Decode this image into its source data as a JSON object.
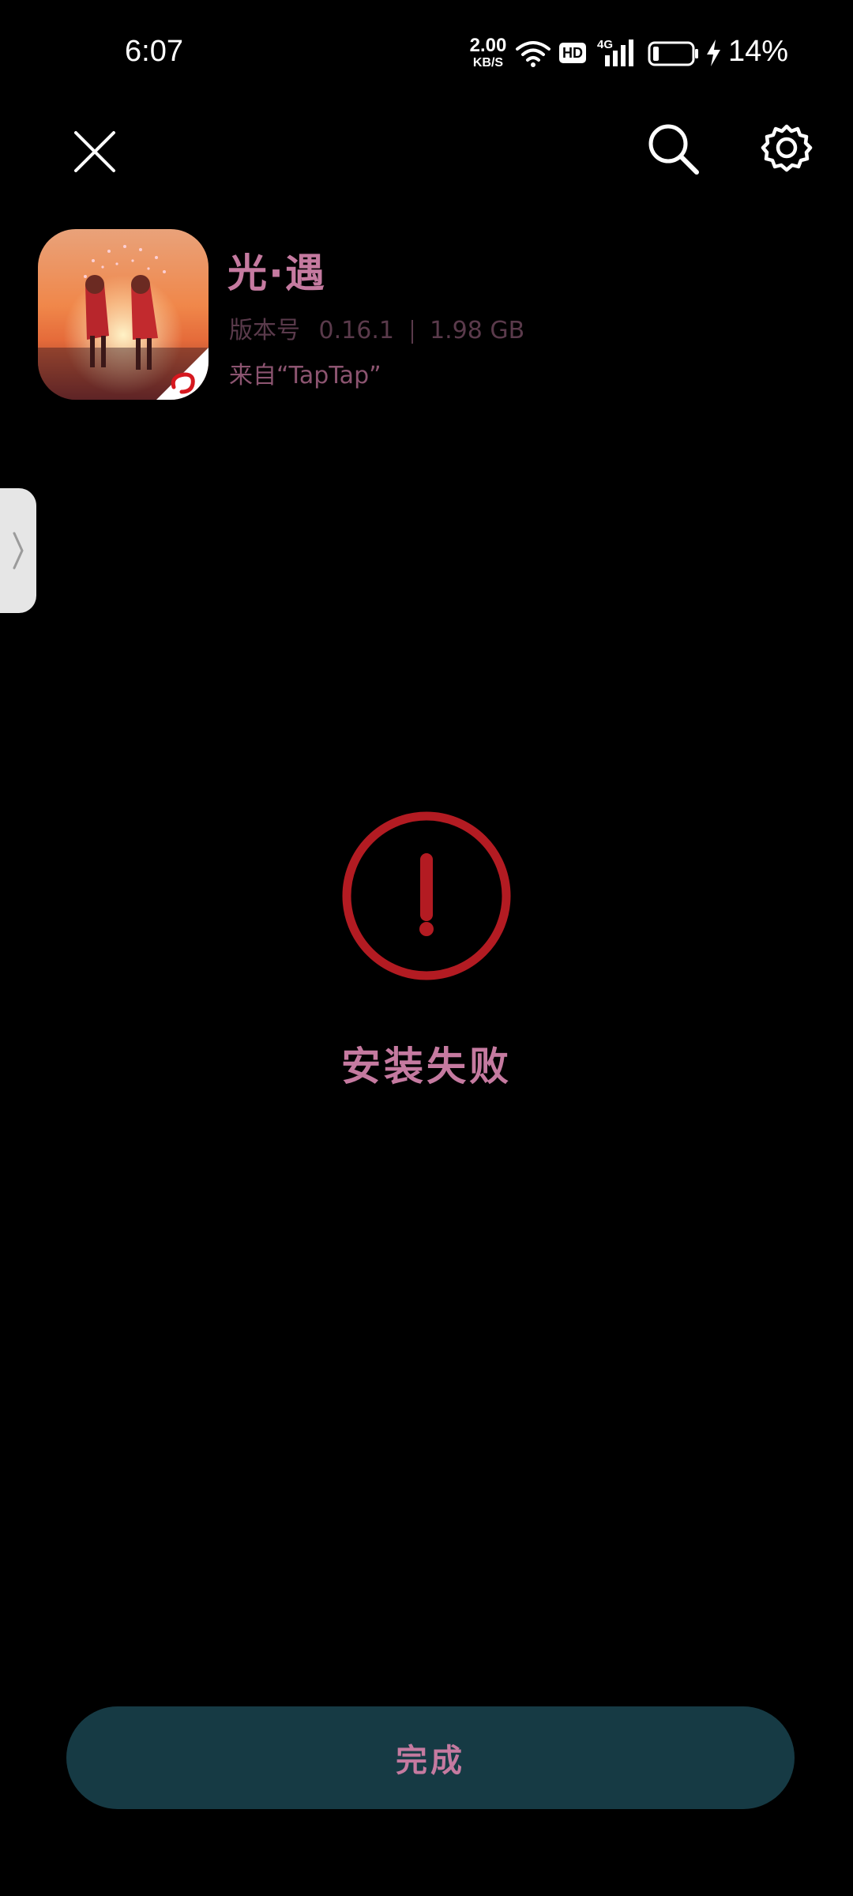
{
  "status_bar": {
    "time": "6:07",
    "net_speed_value": "2.00",
    "net_speed_unit": "KB/S",
    "network_type": "4G",
    "hd_badge": "HD",
    "battery_percent": "14%"
  },
  "toolbar": {
    "close_icon": "close-icon",
    "search_icon": "search-icon",
    "settings_icon": "gear-icon"
  },
  "app": {
    "name": "光·遇",
    "version_label": "版本号",
    "version_value": "0.16.1",
    "size": "1.98 GB",
    "source": "来自“TapTap”"
  },
  "result": {
    "status_text": "安装失败",
    "icon": "error-exclamation-icon",
    "accent_color": "#b31b22"
  },
  "actions": {
    "done_label": "完成"
  },
  "colors": {
    "title_text": "#c57aa0",
    "button_bg": "#163a44",
    "background": "#000000"
  }
}
